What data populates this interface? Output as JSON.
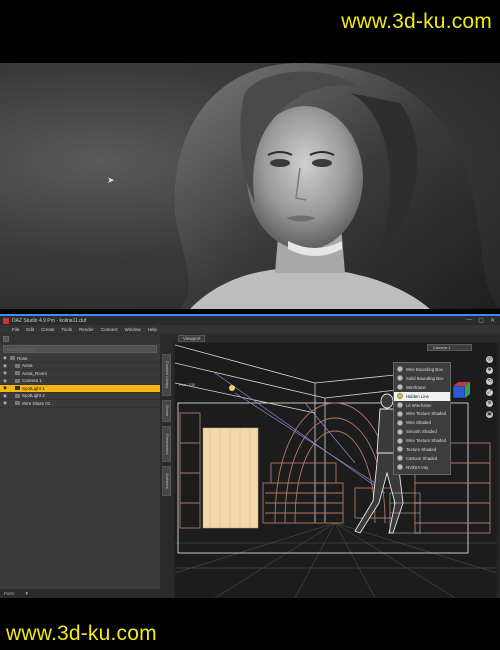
{
  "watermark": {
    "top_text": "www.3d-ku.com",
    "bottom_text": "www.3d-ku.com",
    "color": "#f2ea12"
  },
  "window": {
    "title": "DAZ Studio 4.9 Pro - kolina11.duf",
    "accent": "#3a8ee6",
    "controls": [
      "—",
      "▢",
      "✕"
    ]
  },
  "menu": [
    "File",
    "Edit",
    "Create",
    "Tools",
    "Render",
    "Connect",
    "Window",
    "Help"
  ],
  "scene": {
    "search_placeholder": "Search (Ctrl+F)...",
    "items": [
      {
        "label": "Rose",
        "visible": true,
        "selected": false,
        "indent": 0
      },
      {
        "label": "Anna",
        "visible": true,
        "selected": false,
        "indent": 1
      },
      {
        "label": "Anna_Room",
        "visible": true,
        "selected": false,
        "indent": 1
      },
      {
        "label": "Camera 1",
        "visible": true,
        "selected": false,
        "indent": 1
      },
      {
        "label": "SpotLight 1",
        "visible": true,
        "selected": true,
        "indent": 1
      },
      {
        "label": "SpotLight 2",
        "visible": true,
        "selected": false,
        "indent": 1
      },
      {
        "label": "Wire Glass 01",
        "visible": true,
        "selected": false,
        "indent": 1
      }
    ],
    "status_left": "Parts",
    "status_right": "▼",
    "highlight_color": "#f5b812"
  },
  "side_tabs": [
    "Scene",
    "Parameters",
    "Surfaces",
    "Content Library"
  ],
  "viewport": {
    "tab_label": "Viewport",
    "camera": "Camera 1",
    "info_text": "Pan: 130",
    "draw_style_options": [
      {
        "label": "Wire Bounding Box",
        "active": false
      },
      {
        "label": "Solid Bounding Box",
        "active": false
      },
      {
        "label": "Wireframe",
        "active": false
      },
      {
        "label": "Hidden Line",
        "active": true
      },
      {
        "label": "Lit Wireframe",
        "active": false
      },
      {
        "label": "Wire Texture Shaded",
        "active": false
      },
      {
        "label": "Wire Shaded",
        "active": false
      },
      {
        "label": "Smooth Shaded",
        "active": false
      },
      {
        "label": "Wire Texture Shaded",
        "active": false
      },
      {
        "label": "Texture Shaded",
        "active": false
      },
      {
        "label": "Cartoon Shaded",
        "active": false
      },
      {
        "label": "NVIDIA Iray",
        "active": false
      }
    ],
    "controls": [
      "◎",
      "✥",
      "⟲",
      "⤢",
      "⊕",
      "▣"
    ]
  }
}
